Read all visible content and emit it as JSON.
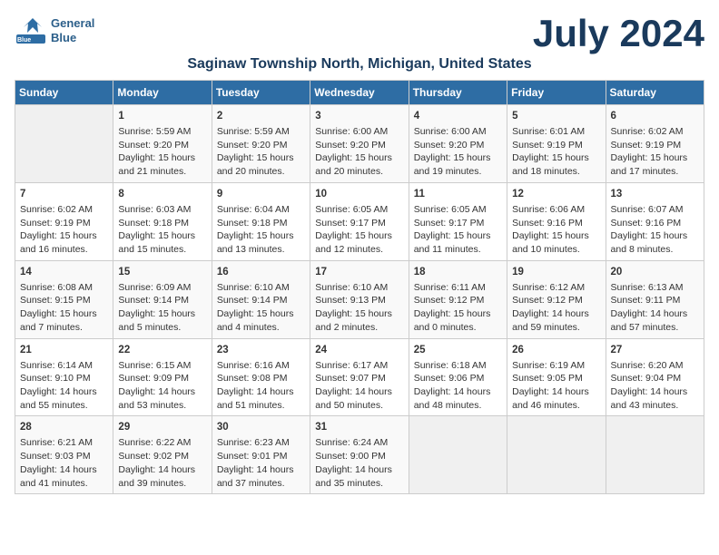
{
  "app": {
    "name": "GeneralBlue",
    "logo_line1": "General",
    "logo_line2": "Blue"
  },
  "calendar": {
    "month_year": "July 2024",
    "location": "Saginaw Township North, Michigan, United States",
    "days_of_week": [
      "Sunday",
      "Monday",
      "Tuesday",
      "Wednesday",
      "Thursday",
      "Friday",
      "Saturday"
    ],
    "weeks": [
      [
        {
          "day": "",
          "content": ""
        },
        {
          "day": "1",
          "content": "Sunrise: 5:59 AM\nSunset: 9:20 PM\nDaylight: 15 hours\nand 21 minutes."
        },
        {
          "day": "2",
          "content": "Sunrise: 5:59 AM\nSunset: 9:20 PM\nDaylight: 15 hours\nand 20 minutes."
        },
        {
          "day": "3",
          "content": "Sunrise: 6:00 AM\nSunset: 9:20 PM\nDaylight: 15 hours\nand 20 minutes."
        },
        {
          "day": "4",
          "content": "Sunrise: 6:00 AM\nSunset: 9:20 PM\nDaylight: 15 hours\nand 19 minutes."
        },
        {
          "day": "5",
          "content": "Sunrise: 6:01 AM\nSunset: 9:19 PM\nDaylight: 15 hours\nand 18 minutes."
        },
        {
          "day": "6",
          "content": "Sunrise: 6:02 AM\nSunset: 9:19 PM\nDaylight: 15 hours\nand 17 minutes."
        }
      ],
      [
        {
          "day": "7",
          "content": "Sunrise: 6:02 AM\nSunset: 9:19 PM\nDaylight: 15 hours\nand 16 minutes."
        },
        {
          "day": "8",
          "content": "Sunrise: 6:03 AM\nSunset: 9:18 PM\nDaylight: 15 hours\nand 15 minutes."
        },
        {
          "day": "9",
          "content": "Sunrise: 6:04 AM\nSunset: 9:18 PM\nDaylight: 15 hours\nand 13 minutes."
        },
        {
          "day": "10",
          "content": "Sunrise: 6:05 AM\nSunset: 9:17 PM\nDaylight: 15 hours\nand 12 minutes."
        },
        {
          "day": "11",
          "content": "Sunrise: 6:05 AM\nSunset: 9:17 PM\nDaylight: 15 hours\nand 11 minutes."
        },
        {
          "day": "12",
          "content": "Sunrise: 6:06 AM\nSunset: 9:16 PM\nDaylight: 15 hours\nand 10 minutes."
        },
        {
          "day": "13",
          "content": "Sunrise: 6:07 AM\nSunset: 9:16 PM\nDaylight: 15 hours\nand 8 minutes."
        }
      ],
      [
        {
          "day": "14",
          "content": "Sunrise: 6:08 AM\nSunset: 9:15 PM\nDaylight: 15 hours\nand 7 minutes."
        },
        {
          "day": "15",
          "content": "Sunrise: 6:09 AM\nSunset: 9:14 PM\nDaylight: 15 hours\nand 5 minutes."
        },
        {
          "day": "16",
          "content": "Sunrise: 6:10 AM\nSunset: 9:14 PM\nDaylight: 15 hours\nand 4 minutes."
        },
        {
          "day": "17",
          "content": "Sunrise: 6:10 AM\nSunset: 9:13 PM\nDaylight: 15 hours\nand 2 minutes."
        },
        {
          "day": "18",
          "content": "Sunrise: 6:11 AM\nSunset: 9:12 PM\nDaylight: 15 hours\nand 0 minutes."
        },
        {
          "day": "19",
          "content": "Sunrise: 6:12 AM\nSunset: 9:12 PM\nDaylight: 14 hours\nand 59 minutes."
        },
        {
          "day": "20",
          "content": "Sunrise: 6:13 AM\nSunset: 9:11 PM\nDaylight: 14 hours\nand 57 minutes."
        }
      ],
      [
        {
          "day": "21",
          "content": "Sunrise: 6:14 AM\nSunset: 9:10 PM\nDaylight: 14 hours\nand 55 minutes."
        },
        {
          "day": "22",
          "content": "Sunrise: 6:15 AM\nSunset: 9:09 PM\nDaylight: 14 hours\nand 53 minutes."
        },
        {
          "day": "23",
          "content": "Sunrise: 6:16 AM\nSunset: 9:08 PM\nDaylight: 14 hours\nand 51 minutes."
        },
        {
          "day": "24",
          "content": "Sunrise: 6:17 AM\nSunset: 9:07 PM\nDaylight: 14 hours\nand 50 minutes."
        },
        {
          "day": "25",
          "content": "Sunrise: 6:18 AM\nSunset: 9:06 PM\nDaylight: 14 hours\nand 48 minutes."
        },
        {
          "day": "26",
          "content": "Sunrise: 6:19 AM\nSunset: 9:05 PM\nDaylight: 14 hours\nand 46 minutes."
        },
        {
          "day": "27",
          "content": "Sunrise: 6:20 AM\nSunset: 9:04 PM\nDaylight: 14 hours\nand 43 minutes."
        }
      ],
      [
        {
          "day": "28",
          "content": "Sunrise: 6:21 AM\nSunset: 9:03 PM\nDaylight: 14 hours\nand 41 minutes."
        },
        {
          "day": "29",
          "content": "Sunrise: 6:22 AM\nSunset: 9:02 PM\nDaylight: 14 hours\nand 39 minutes."
        },
        {
          "day": "30",
          "content": "Sunrise: 6:23 AM\nSunset: 9:01 PM\nDaylight: 14 hours\nand 37 minutes."
        },
        {
          "day": "31",
          "content": "Sunrise: 6:24 AM\nSunset: 9:00 PM\nDaylight: 14 hours\nand 35 minutes."
        },
        {
          "day": "",
          "content": ""
        },
        {
          "day": "",
          "content": ""
        },
        {
          "day": "",
          "content": ""
        }
      ]
    ]
  }
}
